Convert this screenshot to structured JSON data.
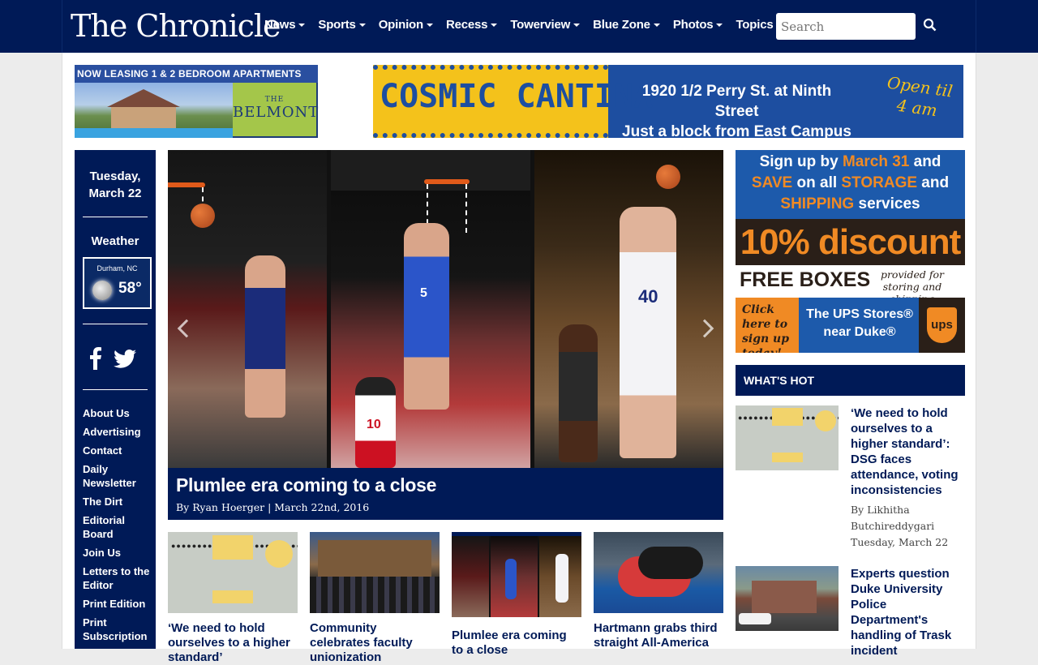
{
  "header": {
    "logo": "The Chronicle",
    "nav": [
      "News",
      "Sports",
      "Opinion",
      "Recess",
      "Towerview",
      "Blue Zone",
      "Photos",
      "Topics"
    ],
    "search_placeholder": "Search"
  },
  "ads": {
    "belmont": {
      "top": "NOW LEASING 1 & 2 BEDROOM APARTMENTS",
      "the": "THE",
      "name": "BELMONT"
    },
    "cantina": {
      "title": "COSMIC CANTINA",
      "addr1": "1920 1/2 Perry St. at Ninth Street",
      "addr2": "Just a block from East Campus",
      "open1": "Open til",
      "open2": "4 am"
    },
    "ups": {
      "line1a": "Sign up by ",
      "line1b": "March 31",
      "line1c": " and",
      "line2a": "SAVE",
      "line2b": " on all ",
      "line2c": "STORAGE",
      "line2d": " and",
      "line3a": "SHIPPING",
      "line3b": " services",
      "discount": "10% discount",
      "boxes": "FREE BOXES",
      "boxes_note": "provided for storing and shipping",
      "click": "Click here to sign up today!",
      "store": "The UPS Stores® near Duke®",
      "logo": "ups"
    }
  },
  "sidebar": {
    "day": "Tuesday,",
    "date": "March 22",
    "weather_title": "Weather",
    "city": "Durham, NC",
    "temp": "58°",
    "links": [
      "About Us",
      "Advertising",
      "Contact",
      "Daily Newsletter",
      "The Dirt",
      "Editorial Board",
      "Join Us",
      "Letters to the Editor",
      "Print Edition",
      "Print Subscription"
    ]
  },
  "feature": {
    "title": "Plumlee era coming to a close",
    "byline": "By Ryan Hoerger | March 22nd, 2016",
    "jerseys": [
      "5",
      "40"
    ],
    "opponent_jersey": "10"
  },
  "stories": [
    {
      "headline": "‘We need to hold ourselves to a higher standard’"
    },
    {
      "headline": "Community celebrates faculty unionization"
    },
    {
      "headline": "Plumlee era coming to a close"
    },
    {
      "headline": "Hartmann grabs third straight All-America"
    }
  ],
  "whats_hot": {
    "title": "WHAT'S HOT",
    "items": [
      {
        "headline": "‘We need to hold ourselves to a higher standard’: DSG faces attendance, voting inconsistencies",
        "author": "By Likhitha Butchireddygari",
        "date": "Tuesday, March 22"
      },
      {
        "headline": "Experts question Duke University Police Department's handling of Trask incident"
      }
    ]
  },
  "colors": {
    "navy": "#001a57",
    "ups_orange": "#f08a24",
    "ups_blue": "#1d5aab"
  }
}
